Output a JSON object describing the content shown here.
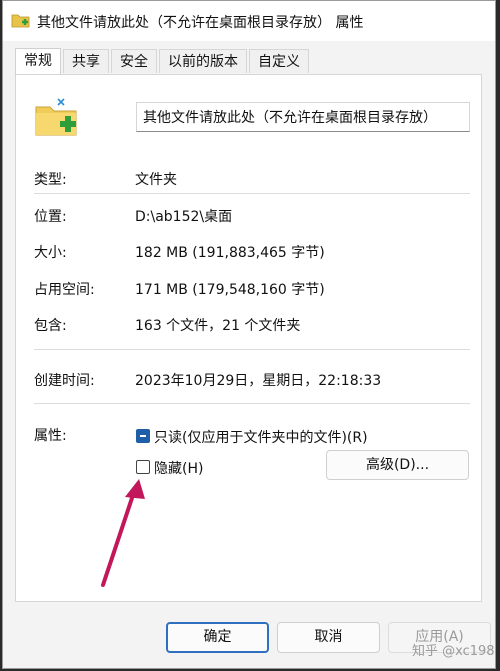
{
  "window": {
    "title": "其他文件请放此处（不允许在桌面根目录存放） 属性"
  },
  "tabs": [
    {
      "label": "常规",
      "active": true
    },
    {
      "label": "共享",
      "active": false
    },
    {
      "label": "安全",
      "active": false
    },
    {
      "label": "以前的版本",
      "active": false
    },
    {
      "label": "自定义",
      "active": false
    }
  ],
  "general": {
    "folder_name": "其他文件请放此处（不允许在桌面根目录存放）",
    "rows": [
      {
        "label": "类型:",
        "value": "文件夹"
      },
      {
        "label": "位置:",
        "value": "D:\\ab152\\桌面"
      },
      {
        "label": "大小:",
        "value": "182 MB (191,883,465 字节)"
      },
      {
        "label": "占用空间:",
        "value": "171 MB (179,548,160 字节)"
      },
      {
        "label": "包含:",
        "value": "163 个文件，21 个文件夹"
      },
      {
        "label": "创建时间:",
        "value": "2023年10月29日，星期日，22:18:33"
      }
    ],
    "attributes_label": "属性:",
    "readonly_label": "只读(仅应用于文件夹中的文件)(R)",
    "hidden_label": "隐藏(H)",
    "advanced_label": "高级(D)..."
  },
  "buttons": {
    "ok": "确定",
    "cancel": "取消",
    "apply": "应用(A)"
  },
  "watermark": "知乎 @xc198",
  "colors": {
    "accent": "#1f5fa8",
    "arrow": "#c2185b"
  }
}
